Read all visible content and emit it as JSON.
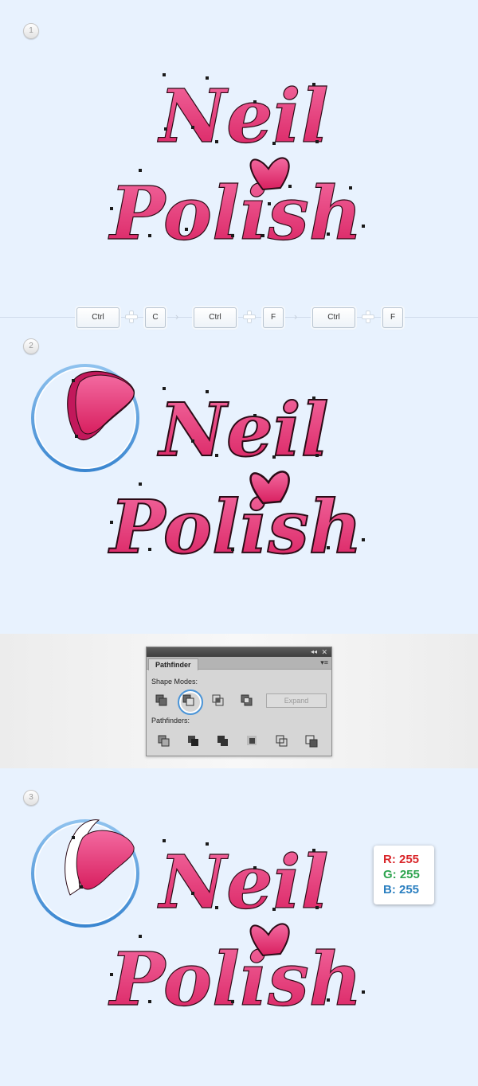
{
  "steps": [
    {
      "number": "1"
    },
    {
      "number": "2"
    },
    {
      "number": "3"
    }
  ],
  "artwork": {
    "word1": "Neil",
    "word2": "Polish",
    "fill_color": "#e8306f",
    "highlight_color": "#f36aa0",
    "outline_color": "#2b0b16",
    "anchor_color": "#1a1a1a"
  },
  "shortcuts": {
    "keys": [
      "Ctrl",
      "C",
      "Ctrl",
      "F",
      "Ctrl",
      "F"
    ],
    "separators": [
      "plus",
      "arrow",
      "plus",
      "arrow",
      "plus"
    ]
  },
  "pathfinder": {
    "tab_label": "Pathfinder",
    "shape_modes_label": "Shape Modes:",
    "pathfinders_label": "Pathfinders:",
    "expand_label": "Expand",
    "selected_mode": "minus-front",
    "shape_mode_icons": [
      "unite-icon",
      "minus-front-icon",
      "intersect-icon",
      "exclude-icon"
    ],
    "pathfinder_icons": [
      "divide-icon",
      "trim-icon",
      "merge-icon",
      "crop-icon",
      "outline-icon",
      "minus-back-icon"
    ]
  },
  "color_card": {
    "r_label": "R: 255",
    "g_label": "G: 255",
    "b_label": "B: 255",
    "r_color": "#d9262a",
    "g_color": "#2ea44f",
    "b_color": "#2b7fc0"
  }
}
